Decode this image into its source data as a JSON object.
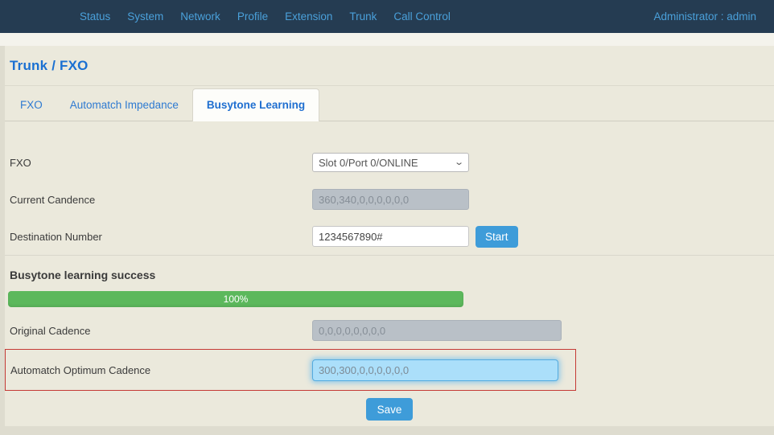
{
  "navbar": {
    "items": [
      "Status",
      "System",
      "Network",
      "Profile",
      "Extension",
      "Trunk",
      "Call Control"
    ],
    "user_label": "Administrator : admin"
  },
  "page": {
    "title": "Trunk / FXO"
  },
  "tabs": [
    {
      "label": "FXO"
    },
    {
      "label": "Automatch Impedance"
    },
    {
      "label": "Busytone Learning"
    }
  ],
  "form": {
    "fxo": {
      "label": "FXO",
      "value": "Slot 0/Port 0/ONLINE"
    },
    "current_cadence": {
      "label": "Current Candence",
      "value": "360,340,0,0,0,0,0,0"
    },
    "destination_number": {
      "label": "Destination Number",
      "value": "1234567890#",
      "start_label": "Start"
    }
  },
  "result": {
    "heading": "Busytone learning success",
    "progress_percent": "100%",
    "original_cadence": {
      "label": "Original Cadence",
      "value": "0,0,0,0,0,0,0,0"
    },
    "automatch_optimum_cadence": {
      "label": "Automatch Optimum Cadence",
      "value": "300,300,0,0,0,0,0,0"
    }
  },
  "actions": {
    "save_label": "Save"
  },
  "colors": {
    "navbar_bg": "#253c52",
    "nav_link": "#4aa0da",
    "panel_bg": "#ebe9dc",
    "title_blue": "#1a70d2",
    "accent_blue": "#3e9cd9",
    "progress_green": "#5cb85c",
    "highlight_input_bg": "#abdffa",
    "highlight_border": "#55abdf",
    "attention_box_red": "#c43a35",
    "disabled_input_bg": "#b9c0c7"
  },
  "icons": {
    "select_chevron": "⌄"
  }
}
